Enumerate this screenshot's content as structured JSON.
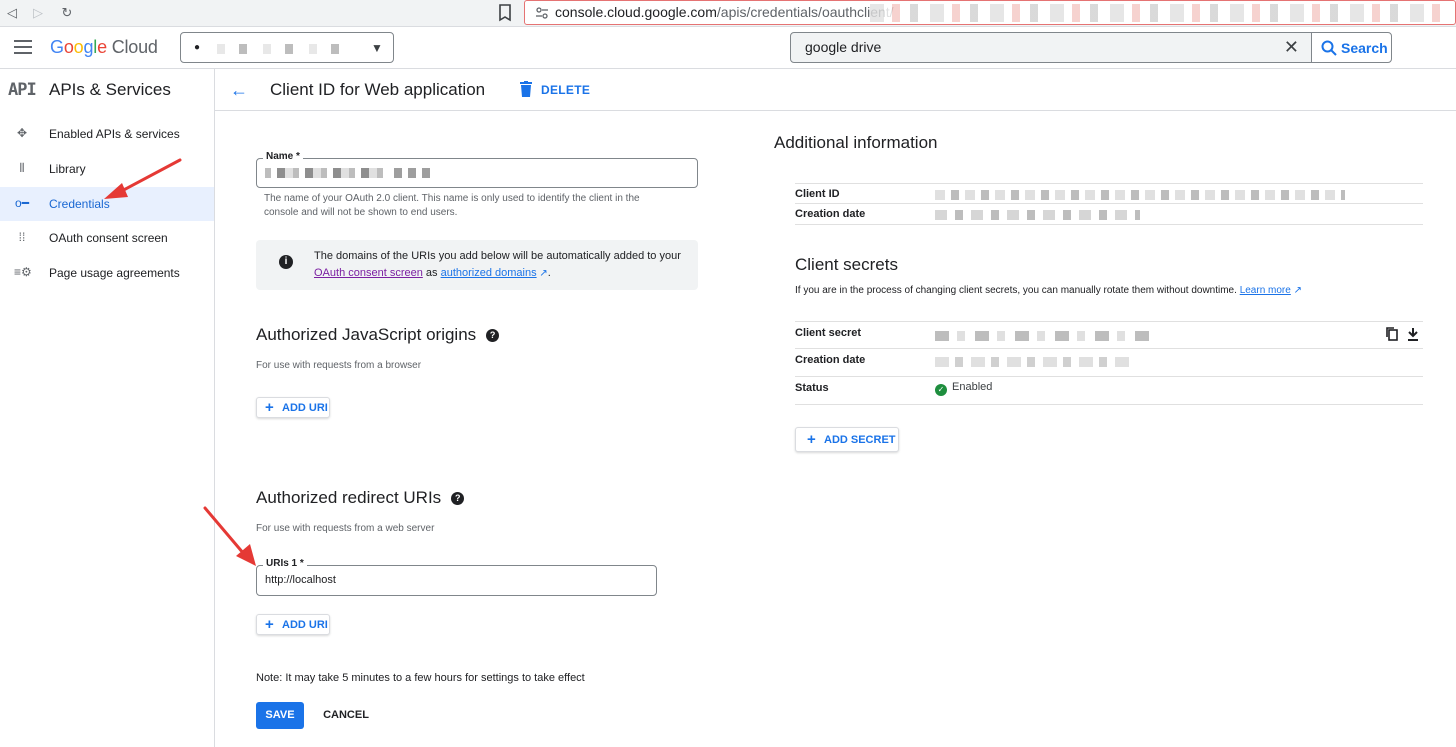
{
  "browser": {
    "url_host": "console.cloud.google.com",
    "url_path": "/apis/credentials/oauthclient/"
  },
  "header": {
    "logo_google": [
      "G",
      "o",
      "o",
      "g",
      "l",
      "e"
    ],
    "logo_cloud": "Cloud",
    "search_value": "google drive",
    "search_button": "Search"
  },
  "sidebar": {
    "api_badge": "API",
    "title": "APIs & Services",
    "items": [
      {
        "label": "Enabled APIs & services",
        "icon": "apis-icon"
      },
      {
        "label": "Library",
        "icon": "library-icon"
      },
      {
        "label": "Credentials",
        "icon": "key-icon",
        "active": true
      },
      {
        "label": "OAuth consent screen",
        "icon": "consent-icon"
      },
      {
        "label": "Page usage agreements",
        "icon": "settings-list-icon"
      }
    ]
  },
  "topbar": {
    "title": "Client ID for Web application",
    "delete_label": "DELETE"
  },
  "form": {
    "name_label": "Name *",
    "name_hint": "The name of your OAuth 2.0 client. This name is only used to identify the client in the console and will not be shown to end users.",
    "info_text_1": "The domains of the URIs you add below will be automatically added to your",
    "info_link_1": "OAuth consent screen",
    "info_text_2": "as",
    "info_link_2": "authorized domains",
    "js_origins_title": "Authorized JavaScript origins",
    "js_origins_sub": "For use with requests from a browser",
    "add_uri_label": "ADD URI",
    "redirect_title": "Authorized redirect URIs",
    "redirect_sub": "For use with requests from a web server",
    "uri_label": "URIs 1 *",
    "uri_value": "http://localhost",
    "note": "Note: It may take 5 minutes to a few hours for settings to take effect",
    "save_label": "SAVE",
    "cancel_label": "CANCEL"
  },
  "additional": {
    "title": "Additional information",
    "client_id_key": "Client ID",
    "creation_date_key": "Creation date",
    "secrets_title": "Client secrets",
    "secrets_desc": "If you are in the process of changing client secrets, you can manually rotate them without downtime.",
    "learn_more": "Learn more",
    "client_secret_key": "Client secret",
    "secret_creation_key": "Creation date",
    "status_key": "Status",
    "status_value": "Enabled",
    "add_secret_label": "ADD SECRET"
  },
  "colors": {
    "accent": "#1a73e8",
    "active_bg": "#e8f0fe",
    "status_green": "#1e8e3e",
    "annotation_red": "#e53935"
  }
}
